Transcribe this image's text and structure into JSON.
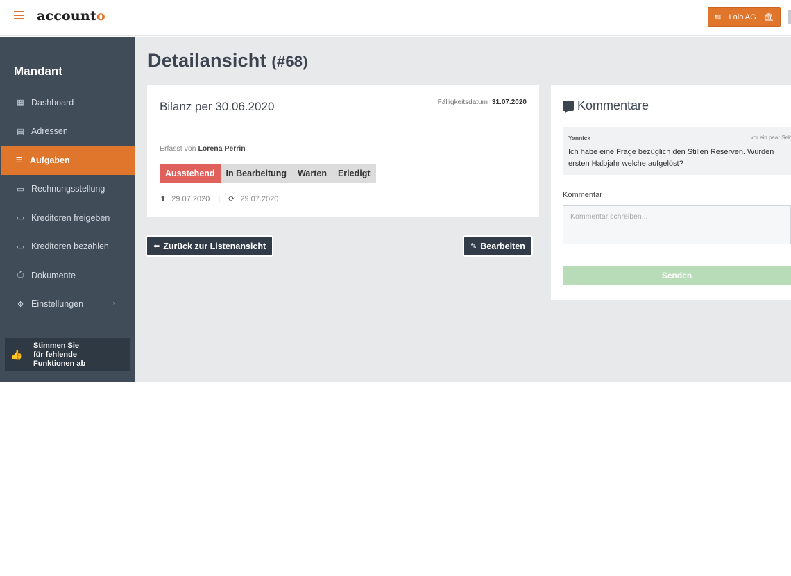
{
  "app": {
    "logo_main": "account",
    "logo_accent": "o",
    "company_label": "Lolo AG"
  },
  "sidebar": {
    "title": "Mandant",
    "items": [
      {
        "label": "Dashboard",
        "icon": "dashboard-icon"
      },
      {
        "label": "Adressen",
        "icon": "address-book-icon"
      },
      {
        "label": "Aufgaben",
        "icon": "tasks-icon",
        "active": true
      },
      {
        "label": "Rechnungsstellung",
        "icon": "invoice-icon"
      },
      {
        "label": "Kreditoren freigeben",
        "icon": "credit-card-icon"
      },
      {
        "label": "Kreditoren bezahlen",
        "icon": "credit-card-icon"
      },
      {
        "label": "Dokumente",
        "icon": "print-icon"
      },
      {
        "label": "Einstellungen",
        "icon": "gear-icon",
        "chevron": "›"
      }
    ],
    "vote": "Stimmen Sie\nfür fehlende\nFunktionen ab"
  },
  "page": {
    "title": "Detailansicht",
    "id_label": "(#68)"
  },
  "task": {
    "title": "Bilanz per 30.06.2020",
    "due_label": "Fälligkeitsdatum",
    "due_value": "31.07.2020",
    "created_by_label": "Erfasst von",
    "created_by": "Lorena Perrin",
    "statuses": [
      "Ausstehend",
      "In Bearbeitung",
      "Warten",
      "Erledigt"
    ],
    "active_status": "Ausstehend",
    "created_date": "29.07.2020",
    "separator": "|",
    "updated_date": "29.07.2020"
  },
  "actions": {
    "back_label": "Zurück zur Listenansicht",
    "edit_label": "Bearbeiten"
  },
  "comments": {
    "title": "Kommentare",
    "messages": [
      {
        "author": "Yannick",
        "time": "vor ein paar Sek",
        "line1": "Ich habe eine Frage bezüglich den Stillen Reserven. Wurden",
        "line2": "ersten Halbjahr welche aufgelöst?"
      }
    ],
    "field_label": "Kommentar",
    "placeholder": "Kommentar schreiben...",
    "send_label": "Senden"
  },
  "colors": {
    "accent": "#e0762b",
    "sidebar_bg": "#414c59",
    "status_active": "#e0615c",
    "send_disabled": "#b9dcb8"
  }
}
